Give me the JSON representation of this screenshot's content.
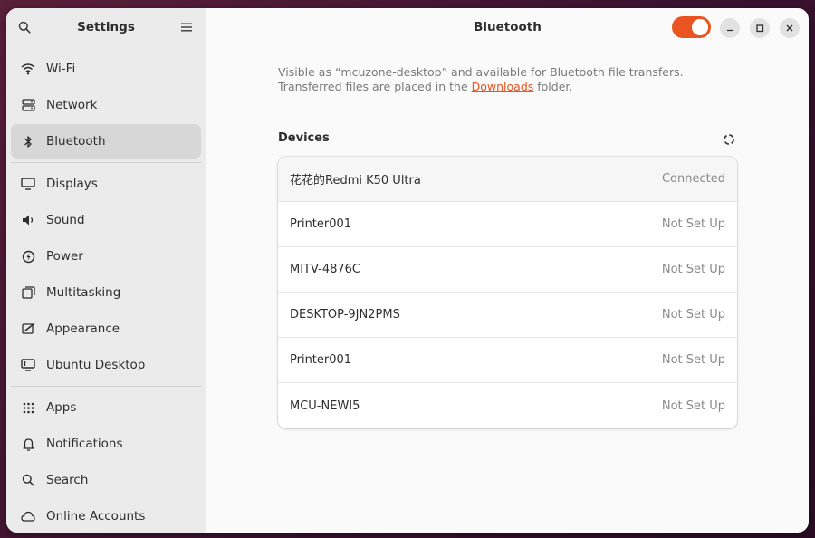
{
  "sidebar": {
    "title": "Settings",
    "items": [
      {
        "label": "Wi-Fi",
        "icon": "wifi-icon"
      },
      {
        "label": "Network",
        "icon": "network-icon"
      },
      {
        "label": "Bluetooth",
        "icon": "bluetooth-icon",
        "active": true
      },
      {
        "label": "Displays",
        "icon": "display-icon"
      },
      {
        "label": "Sound",
        "icon": "sound-icon"
      },
      {
        "label": "Power",
        "icon": "power-icon"
      },
      {
        "label": "Multitasking",
        "icon": "multitasking-icon"
      },
      {
        "label": "Appearance",
        "icon": "appearance-icon"
      },
      {
        "label": "Ubuntu Desktop",
        "icon": "ubuntu-desktop-icon"
      },
      {
        "label": "Apps",
        "icon": "apps-icon"
      },
      {
        "label": "Notifications",
        "icon": "bell-icon"
      },
      {
        "label": "Search",
        "icon": "search-icon"
      },
      {
        "label": "Online Accounts",
        "icon": "cloud-icon"
      }
    ]
  },
  "main": {
    "title": "Bluetooth",
    "bluetooth_enabled": true,
    "description_before": "Visible as “mcuzone-desktop” and available for Bluetooth file transfers. Transferred files are placed in the ",
    "description_link": "Downloads",
    "description_after": " folder.",
    "devices_title": "Devices",
    "devices": [
      {
        "name": "花花的Redmi K50 Ultra",
        "status": "Connected"
      },
      {
        "name": "Printer001",
        "status": "Not Set Up"
      },
      {
        "name": "MITV-4876C",
        "status": "Not Set Up"
      },
      {
        "name": "DESKTOP-9JN2PMS",
        "status": "Not Set Up"
      },
      {
        "name": "Printer001",
        "status": "Not Set Up"
      },
      {
        "name": "MCU-NEWI5",
        "status": "Not Set Up"
      }
    ]
  },
  "colors": {
    "accent": "#e95420",
    "sidebar_bg": "#ebebeb",
    "content_bg": "#fafafa"
  }
}
